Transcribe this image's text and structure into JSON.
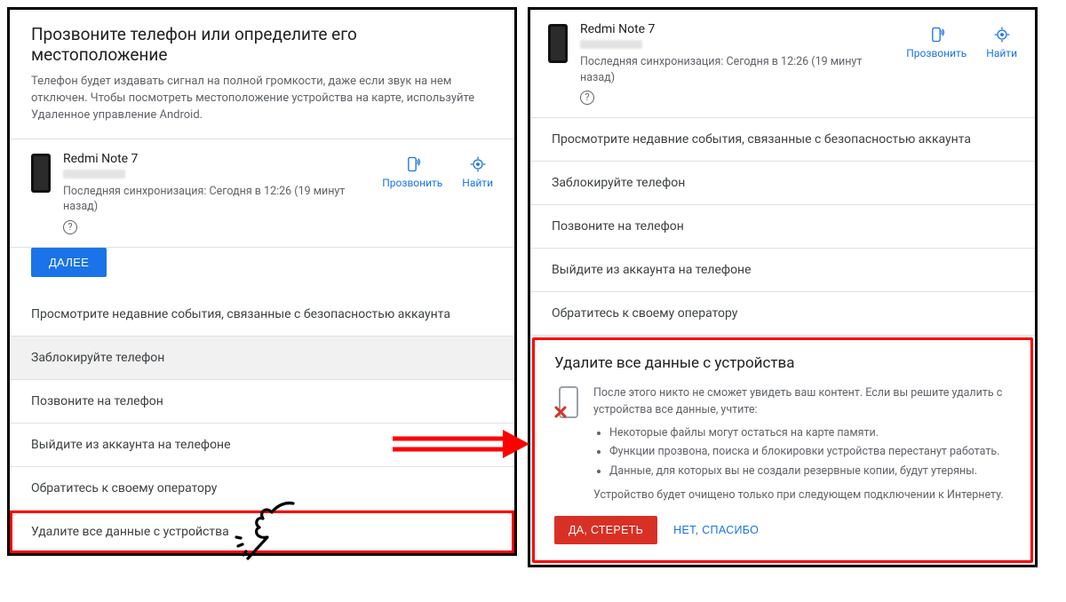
{
  "left": {
    "title": "Прозвоните телефон или определите его местоположение",
    "desc": "Телефон будет издавать сигнал на полной громкости, даже если звук на нем отключен. Чтобы посмотреть местоположение устройства на карте, используйте Удаленное управление Android.",
    "device_name": "Redmi Note 7",
    "sync": "Последняя синхронизация: Сегодня в 12:26 (19 минут назад)",
    "action_call": "Прозвонить",
    "action_find": "Найти",
    "next": "ДАЛЕЕ",
    "rows": [
      "Просмотрите недавние события, связанные с безопасностью аккаунта",
      "Заблокируйте телефон",
      "Позвоните на телефон",
      "Выйдите из аккаунта на телефоне",
      "Обратитесь к своему оператору",
      "Удалите все данные с устройства"
    ]
  },
  "right": {
    "device_name": "Redmi Note 7",
    "sync": "Последняя синхронизация: Сегодня в 12:26 (19 минут назад)",
    "action_call": "Прозвонить",
    "action_find": "Найти",
    "rows": [
      "Просмотрите недавние события, связанные с безопасностью аккаунта",
      "Заблокируйте телефон",
      "Позвоните на телефон",
      "Выйдите из аккаунта на телефоне",
      "Обратитесь к своему оператору"
    ],
    "erase": {
      "title": "Удалите все данные с устройства",
      "intro": "После этого никто не сможет увидеть ваш контент. Если вы решите удалить с устройства все данные, учтите:",
      "b1": "Некоторые файлы могут остаться на карте памяти.",
      "b2": "Функции прозвона, поиска и блокировки устройства перестанут работать.",
      "b3": "Данные, для которых вы не создали резервные копии, будут утеряны.",
      "outro": "Устройство будет очищено только при следующем подключении к Интернету.",
      "yes": "ДА, СТЕРЕТЬ",
      "no": "НЕТ, СПАСИБО"
    }
  }
}
